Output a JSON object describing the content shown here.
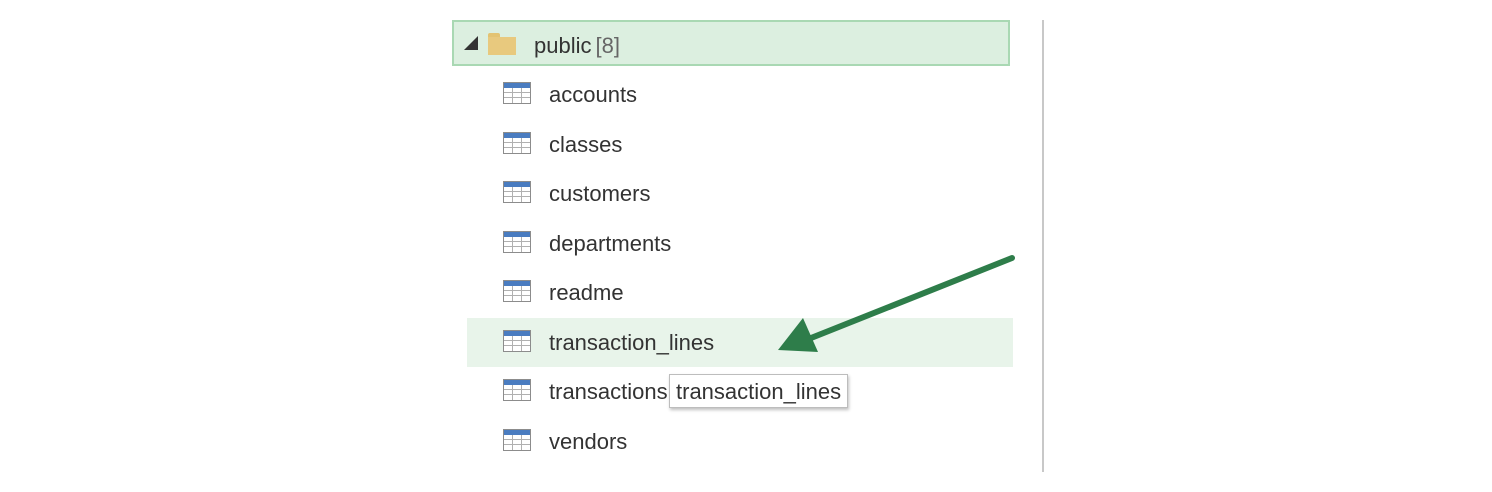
{
  "folder": {
    "name": "public",
    "count": "[8]",
    "icon": "folder-icon"
  },
  "tables": [
    {
      "label": "accounts",
      "icon": "table-icon"
    },
    {
      "label": "classes",
      "icon": "table-icon"
    },
    {
      "label": "customers",
      "icon": "table-icon"
    },
    {
      "label": "departments",
      "icon": "table-icon"
    },
    {
      "label": "readme",
      "icon": "table-icon"
    },
    {
      "label": "transaction_lines",
      "icon": "table-icon",
      "selected": true
    },
    {
      "label": "transactions",
      "icon": "table-icon"
    },
    {
      "label": "vendors",
      "icon": "table-icon"
    }
  ],
  "tooltip": {
    "text": "transaction_lines"
  },
  "colors": {
    "folder_highlight": "#dcefe0",
    "selected_row": "#e8f4ea",
    "arrow": "#2e7d4a"
  }
}
